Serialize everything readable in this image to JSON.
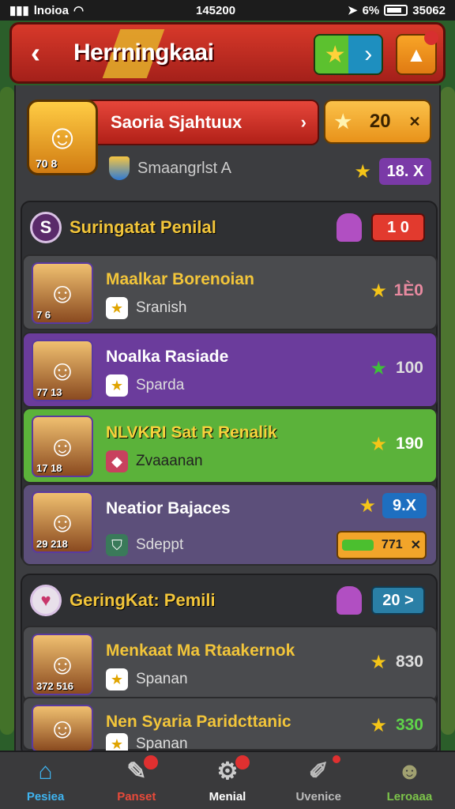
{
  "status_bar": {
    "carrier": "lnoioa",
    "time": "145200",
    "battery_pct": "6%",
    "right_text": "35062"
  },
  "header": {
    "title": "Herrningkaai"
  },
  "profile": {
    "name": "Saoria Sjahtuux",
    "coins": "20",
    "subtitle": "Smaangrlst A",
    "stat": "18. X",
    "avatar_stats": "70 8"
  },
  "sections": [
    {
      "title": "Suringatat Penilal",
      "icon_letter": "S",
      "pill": "1 0",
      "rows": [
        {
          "name": "Maalkar Borenoian",
          "sub": "Sranish",
          "value": "1Ѐ0",
          "avatar_stats": "7 6"
        },
        {
          "name": "Noalka Rasiade",
          "sub": "Sparda",
          "value": "100",
          "avatar_stats": "77 13"
        },
        {
          "name": "NLVKRI Sat R Renalik",
          "sub": "Zvaaanan",
          "value": "190",
          "avatar_stats": "17 18"
        },
        {
          "name": "Neatior Bajaces",
          "sub": "Sdeppt",
          "value": "9.X",
          "bar_value": "771",
          "avatar_stats": "29 218"
        }
      ]
    },
    {
      "title": "GeringKat: Pemili",
      "icon_letter": "♥",
      "pill": "20 >",
      "rows": [
        {
          "name": "Menkaat Ma Rtaakernok",
          "sub": "Spanan",
          "value": "830",
          "avatar_stats": "372 516"
        },
        {
          "name": "Nen Syaria Paridcttanic",
          "sub": "Spanan",
          "value": "330",
          "avatar_stats": ""
        }
      ]
    }
  ],
  "tabs": [
    {
      "label": "Pesiea",
      "icon": "home-icon",
      "color": "#3fb4f0"
    },
    {
      "label": "Panset",
      "icon": "wrench-icon",
      "color": "#e84a3a"
    },
    {
      "label": "Menial",
      "icon": "gear-icon",
      "color": "#ffffff"
    },
    {
      "label": "Uvenice",
      "icon": "edit-icon",
      "color": "#bbbbbb"
    },
    {
      "label": "Leroaaa",
      "icon": "user-icon",
      "color": "#7cc44a"
    }
  ]
}
